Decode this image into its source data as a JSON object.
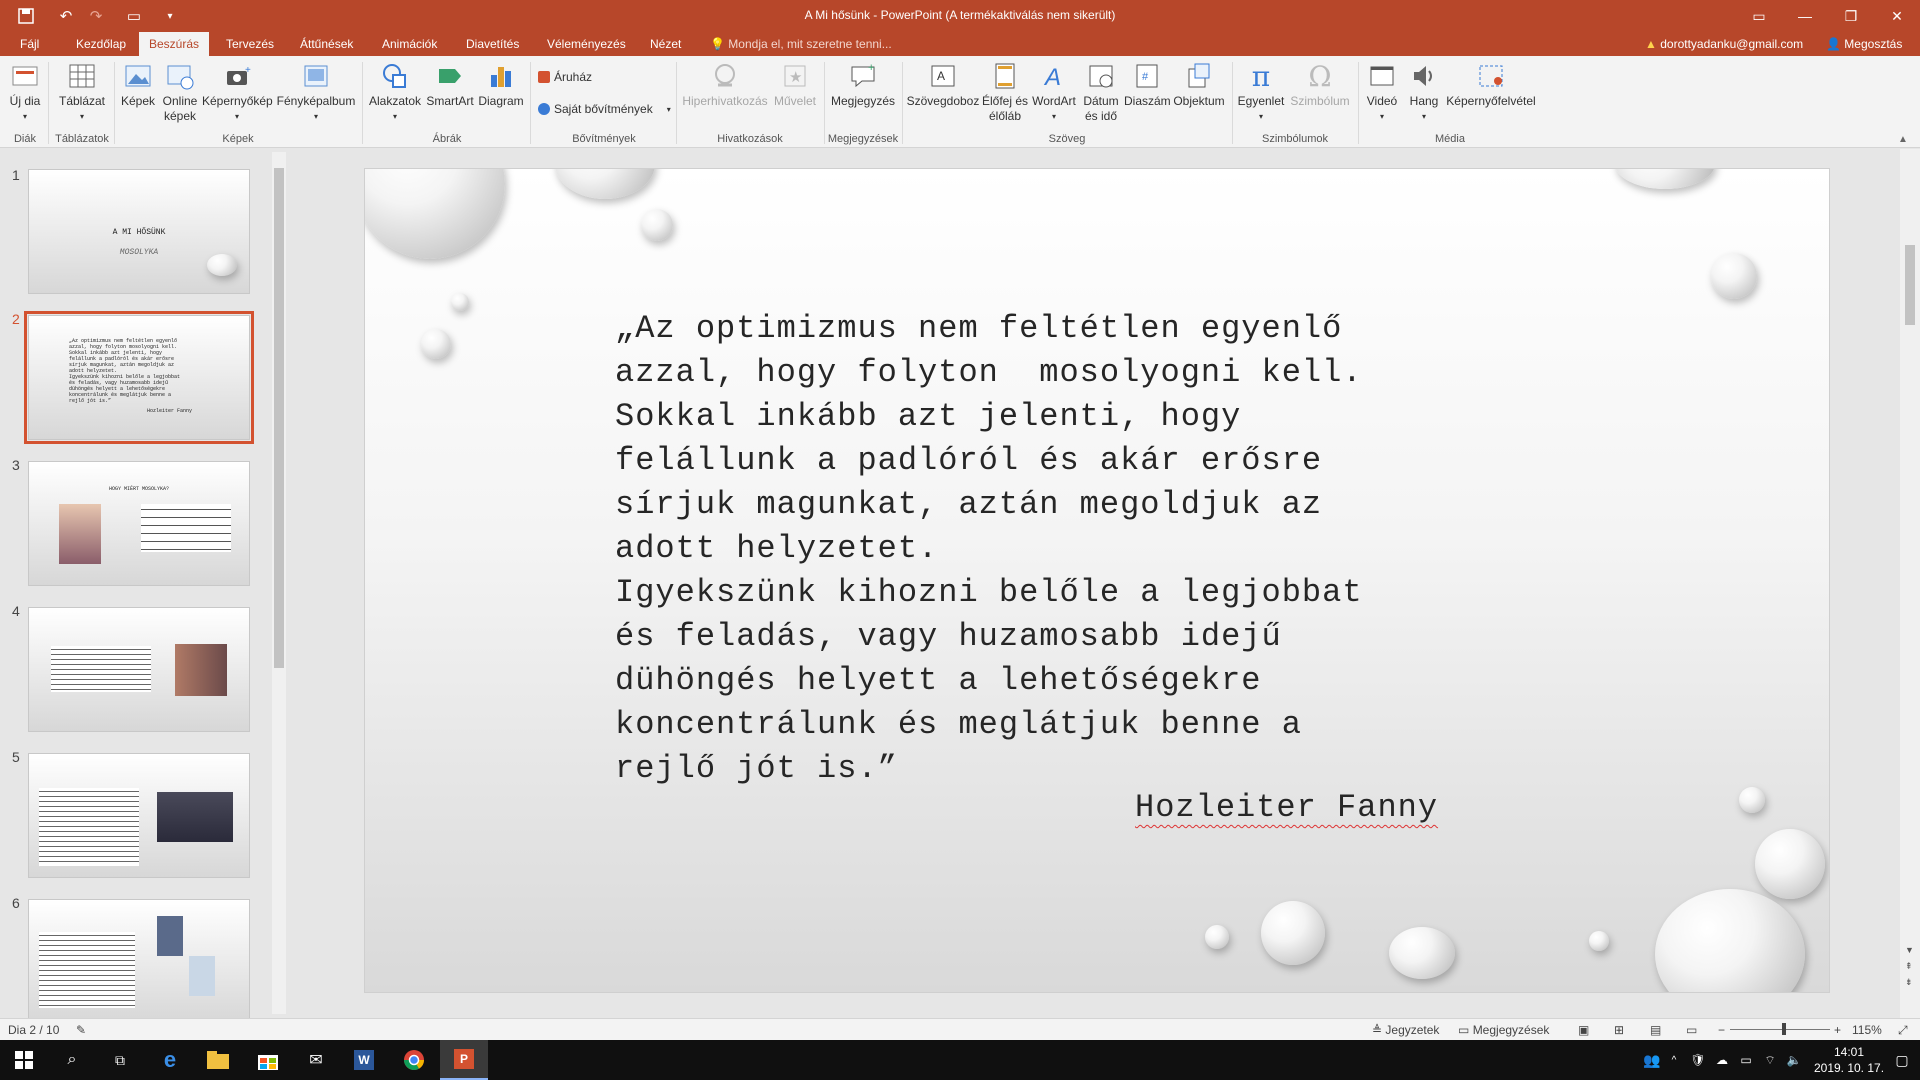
{
  "window": {
    "title": "A Mi hősünk - PowerPoint (A termékaktiválás nem sikerült)"
  },
  "tabs": [
    "Fájl",
    "Kezdőlap",
    "Beszúrás",
    "Tervezés",
    "Áttűnések",
    "Animációk",
    "Diavetítés",
    "Véleményezés",
    "Nézet"
  ],
  "active_tab": "Beszúrás",
  "tell_me": "Mondja el, mit szeretne tenni...",
  "account": {
    "email": "dorottyadanku@gmail.com",
    "share": "Megosztás"
  },
  "ribbon": {
    "groups": {
      "slides": "Diák",
      "tables": "Táblázatok",
      "images": "Képek",
      "illustrations": "Ábrák",
      "addins": "Bővítmények",
      "links": "Hivatkozások",
      "comments": "Megjegyzések",
      "text": "Szöveg",
      "symbols": "Szimbólumok",
      "media": "Média"
    },
    "buttons": {
      "new_slide": [
        "Új dia"
      ],
      "table": [
        "Táblázat"
      ],
      "pictures": [
        "Képek"
      ],
      "online_pictures": [
        "Online",
        "képek"
      ],
      "screenshot": [
        "Képernyőkép"
      ],
      "photo_album": [
        "Fényképalbum"
      ],
      "shapes": [
        "Alakzatok"
      ],
      "smartart": [
        "SmartArt"
      ],
      "chart": [
        "Diagram"
      ],
      "store": "Áruház",
      "my_addins": "Saját bővítmények",
      "hyperlink": [
        "Hiperhivatkozás"
      ],
      "action": [
        "Művelet"
      ],
      "comment": [
        "Megjegyzés"
      ],
      "textbox": [
        "Szövegdoboz"
      ],
      "header_footer": [
        "Élőfej és",
        "élőláb"
      ],
      "wordart": [
        "WordArt"
      ],
      "datetime": [
        "Dátum",
        "és idő"
      ],
      "slide_number": [
        "Diaszám"
      ],
      "object": [
        "Objektum"
      ],
      "equation": [
        "Egyenlet"
      ],
      "symbol": [
        "Szimbólum"
      ],
      "video": [
        "Videó"
      ],
      "audio": [
        "Hang"
      ],
      "screen_recording": [
        "Képernyőfelvétel"
      ]
    }
  },
  "thumbnails": [
    {
      "number": "1",
      "lines": [
        "A MI HŐSÜNK",
        "MOSOLYKA"
      ]
    },
    {
      "number": "2",
      "lines": [
        "„Az optimizmus nem feltétlen egyenlő",
        "azzal, hogy folyton  mosolyogni kell.",
        "Sokkal inkább azt jelenti, hogy",
        "felállunk a padlóról és akár erősre",
        "sírjuk magunkat, aztán megoldjuk az",
        "adott helyzetet.",
        "Igyekszünk kihozni belőle a legjobbat",
        "és feladás, vagy huzamosabb idejű",
        "dühöngés helyett a lehetőségekre",
        "koncentrálunk és meglátjuk benne a",
        "rejlő jót is.”",
        "Hozleiter Fanny"
      ]
    },
    {
      "number": "3",
      "lines": [
        "HOGY MIÉRT MOSOLYKA?"
      ]
    },
    {
      "number": "4",
      "lines": []
    },
    {
      "number": "5",
      "lines": []
    },
    {
      "number": "6",
      "lines": []
    }
  ],
  "slide": {
    "quote": "„Az optimizmus nem feltétlen egyenlő\nazzal, hogy folyton  mosolyogni kell.\nSokkal inkább azt jelenti, hogy\nfelállunk a padlóról és akár erősre\nsírjuk magunkat, aztán megoldjuk az\nadott helyzetet.\nIgyekszünk kihozni belőle a legjobbat\nés feladás, vagy huzamosabb idejű\ndühöngés helyett a lehetőségekre\nkoncentrálunk és meglátjuk benne a\nrejlő jót is.”",
    "author": "Hozleiter Fanny"
  },
  "statusbar": {
    "slide_count": "Dia 2 / 10",
    "notes": "Jegyzetek",
    "comments": "Megjegyzések",
    "zoom": "115%"
  },
  "taskbar": {
    "time": "14:01",
    "date": "2019. 10. 17."
  },
  "colors": {
    "accent": "#b7472a",
    "selection": "#d35230"
  }
}
